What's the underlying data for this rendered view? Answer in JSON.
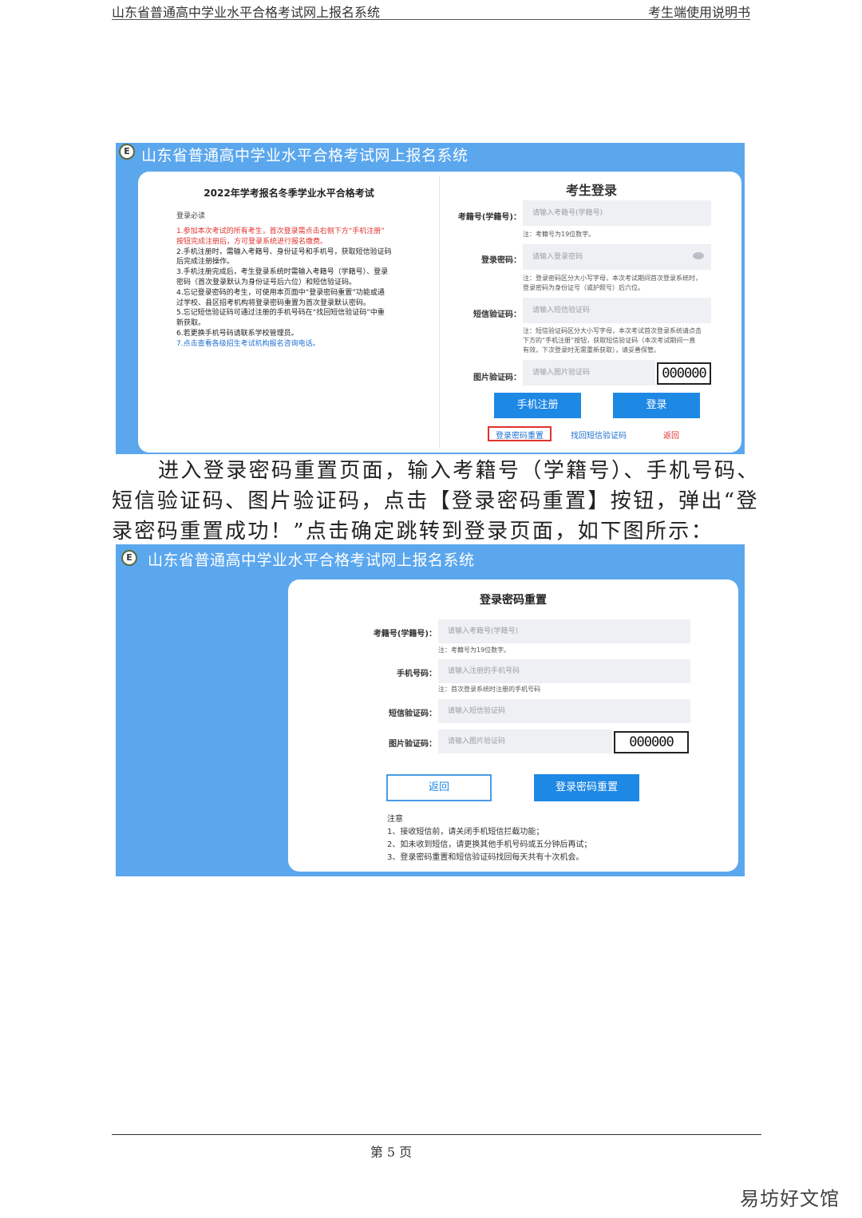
{
  "page_header": {
    "left": "山东省普通高中学业水平合格考试网上报名系统",
    "right": "考生端使用说明书"
  },
  "shot1": {
    "system_title": "山东省普通高中学业水平合格考试网上报名系统",
    "logo_letter": "E",
    "left_panel": {
      "exam_title": "2022年学考报名冬季学业水平合格考试",
      "notice_heading": "登录必读",
      "rule_lines": [
        "1.参加本次考试的所有考生，首次登录需点击右侧下方“手机注册”",
        "按钮完成注册后，方可登录系统进行报名缴费。",
        "2.手机注册时，需输入考籍号、身份证号和手机号，获取短信验证码",
        "后完成注册操作。",
        "3.手机注册完成后，考生登录系统时需输入考籍号（学籍号）、登录",
        "密码（首次登录默认为身份证号后六位）和短信验证码。",
        "4.忘记登录密码的考生，可使用本页面中“登录密码重置”功能或通",
        "过学校、县区招考机构将登录密码重置为首次登录默认密码。",
        "5.忘记短信验证码可通过注册的手机号码在“找回短信验证码”中重",
        "新获取。",
        "6.若更换手机号码请联系学校管理员。"
      ],
      "rule_last_prefix": "7.",
      "rule_last_link": "点击查看各级招生考试机构报名咨询电话",
      "rule_last_suffix": "。"
    },
    "right_panel": {
      "title": "考生登录",
      "fields": [
        {
          "label": "考籍号(学籍号)：",
          "placeholder": "请输入考籍号(学籍号)"
        },
        {
          "label": "登录密码：",
          "placeholder": "请输入登录密码"
        },
        {
          "label": "短信验证码：",
          "placeholder": "请输入短信验证码"
        },
        {
          "label": "图片验证码：",
          "placeholder": "请输入图片验证码"
        }
      ],
      "note_exam_no": "注：考籍号为19位数字。",
      "note_password_1": "注：登录密码区分大小写字母，本次考试期间首次登录系统时，",
      "note_password_2": "登录密码为身份证号（或护照号）后六位。",
      "note_sms_1": "注：短信验证码区分大小写字母，本次考试首次登录系统请点击",
      "note_sms_2": "下方的“手机注册”按钮，获取短信验证码（本次考试期间一直",
      "note_sms_3": "有效，下次登录时无需重新获取），请妥善保管。",
      "captcha": "000000",
      "btn_register": "手机注册",
      "btn_login": "登录",
      "link_reset": "登录密码重置",
      "link_find_sms": "找回短信验证码",
      "link_back": "返回"
    }
  },
  "paragraph": {
    "line1": "进入登录密码重置页面，输入考籍号（学籍号）、手机号码、",
    "line2": "短信验证码、图片验证码，点击【登录密码重置】按钮，弹出“登",
    "line3": "录密码重置成功！”点击确定跳转到登录页面，如下图所示："
  },
  "shot2": {
    "system_title": "山东省普通高中学业水平合格考试网上报名系统",
    "logo_letter": "E",
    "form_title": "登录密码重置",
    "fields": [
      {
        "label": "考籍号(学籍号)：",
        "placeholder": "请输入考籍号(学籍号)"
      },
      {
        "label": "手机号码：",
        "placeholder": "请输入注册的手机号码"
      },
      {
        "label": "短信验证码：",
        "placeholder": "请输入短信验证码"
      },
      {
        "label": "图片验证码：",
        "placeholder": "请输入图片验证码"
      }
    ],
    "note_exam_no": "注：考籍号为19位数字。",
    "note_phone": "注：首次登录系统时注册的手机号码",
    "captcha": "000000",
    "btn_back": "返回",
    "btn_reset": "登录密码重置",
    "notice_heading": "注意",
    "notice_lines": [
      "1、接收短信前，请关闭手机短信拦截功能；",
      "2、如未收到短信，请更换其他手机号码或五分钟后再试；",
      "3、登录密码重置和短信验证码找回每天共有十次机会。"
    ]
  },
  "page_number": "第 5 页",
  "watermark": "易坊好文馆"
}
